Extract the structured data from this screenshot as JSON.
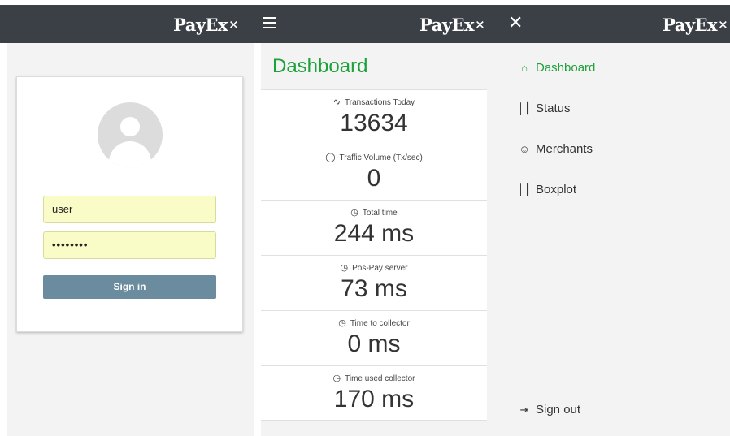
{
  "brand": "PayEx",
  "login": {
    "username_value": "user",
    "password_value": "••••••••",
    "signin_label": "Sign in"
  },
  "dashboard": {
    "title": "Dashboard",
    "stats": [
      {
        "label": "Transactions Today",
        "icon": "activity-icon",
        "value": "13634"
      },
      {
        "label": "Traffic Volume (Tx/sec)",
        "icon": "drop-icon",
        "value": "0"
      },
      {
        "label": "Total time",
        "icon": "clock-icon",
        "value": "244 ms"
      },
      {
        "label": "Pos-Pay server",
        "icon": "clock-icon",
        "value": "73 ms"
      },
      {
        "label": "Time to collector",
        "icon": "clock-icon",
        "value": "0 ms"
      },
      {
        "label": "Time used collector",
        "icon": "clock-icon",
        "value": "170 ms"
      }
    ]
  },
  "nav": {
    "items": [
      {
        "label": "Dashboard",
        "icon": "home-icon",
        "active": true
      },
      {
        "label": "Status",
        "icon": "bar-chart-icon"
      },
      {
        "label": "Merchants",
        "icon": "users-icon"
      },
      {
        "label": "Boxplot",
        "icon": "bar-chart-icon"
      }
    ],
    "signout_label": "Sign out",
    "signout_icon": "sign-out-icon"
  },
  "colors": {
    "topbar": "#3b3f46",
    "accent_green": "#1da23a",
    "button": "#6a8c9e",
    "autofill": "#fafcc8"
  }
}
